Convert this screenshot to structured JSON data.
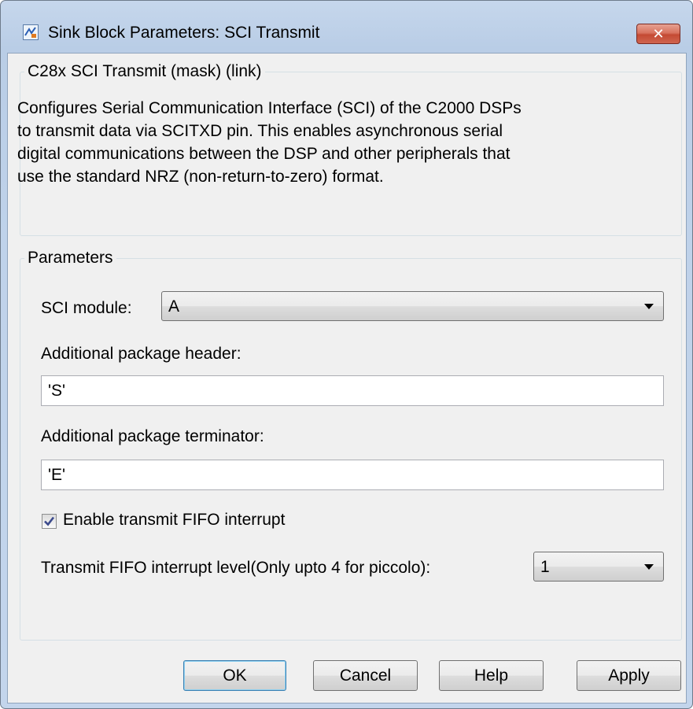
{
  "window": {
    "title": "Sink Block Parameters: SCI Transmit",
    "close_glyph": "✕",
    "icon": "simulink-block-icon"
  },
  "mask": {
    "legend": "C28x SCI Transmit (mask) (link)",
    "description_lines": [
      "Configures Serial Communication Interface (SCI) of the C2000 DSPs",
      "to transmit data via SCITXD pin. This enables asynchronous serial",
      "digital communications between the DSP and other peripherals that",
      "use the standard NRZ (non-return-to-zero) format."
    ]
  },
  "parameters": {
    "legend": "Parameters",
    "sci_module": {
      "label": "SCI module:",
      "value": "A"
    },
    "header": {
      "label": "Additional package header:",
      "value": "'S'"
    },
    "terminator": {
      "label": "Additional package terminator:",
      "value": "'E'"
    },
    "fifo_enable": {
      "label": "Enable transmit FIFO interrupt",
      "checked": true
    },
    "fifo_level": {
      "label": "Transmit FIFO interrupt level(Only upto 4 for piccolo):",
      "value": "1"
    }
  },
  "buttons": {
    "ok": "OK",
    "cancel": "Cancel",
    "help": "Help",
    "apply": "Apply"
  },
  "colors": {
    "close_button": "#c44a33",
    "checkmark": "#3b4a8c"
  }
}
